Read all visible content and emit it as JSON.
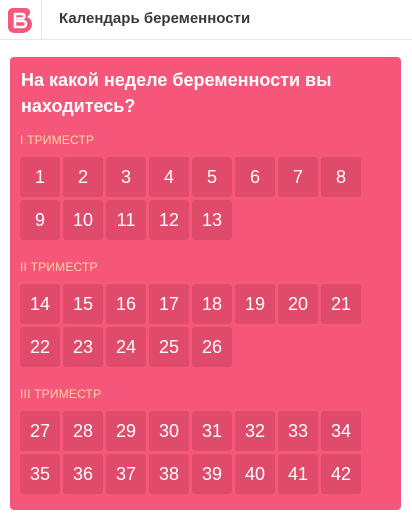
{
  "header": {
    "logo_icon": "pink-b-logo-icon",
    "title": "Календарь беременности"
  },
  "card": {
    "question": "На какой неделе беременности вы находитесь?",
    "trimesters": [
      {
        "label": "I ТРИМЕСТР",
        "weeks": [
          "1",
          "2",
          "3",
          "4",
          "5",
          "6",
          "7",
          "8",
          "9",
          "10",
          "11",
          "12",
          "13"
        ]
      },
      {
        "label": "II ТРИМЕСТР",
        "weeks": [
          "14",
          "15",
          "16",
          "17",
          "18",
          "19",
          "20",
          "21",
          "22",
          "23",
          "24",
          "25",
          "26"
        ]
      },
      {
        "label": "III ТРИМЕСТР",
        "weeks": [
          "27",
          "28",
          "29",
          "30",
          "31",
          "32",
          "33",
          "34",
          "35",
          "36",
          "37",
          "38",
          "39",
          "40",
          "41",
          "42"
        ]
      }
    ]
  },
  "colors": {
    "card_background": "#f4577a",
    "week_button": "#e04a6b",
    "trimester_label": "#ffd8a0",
    "logo": "#f4577a"
  }
}
